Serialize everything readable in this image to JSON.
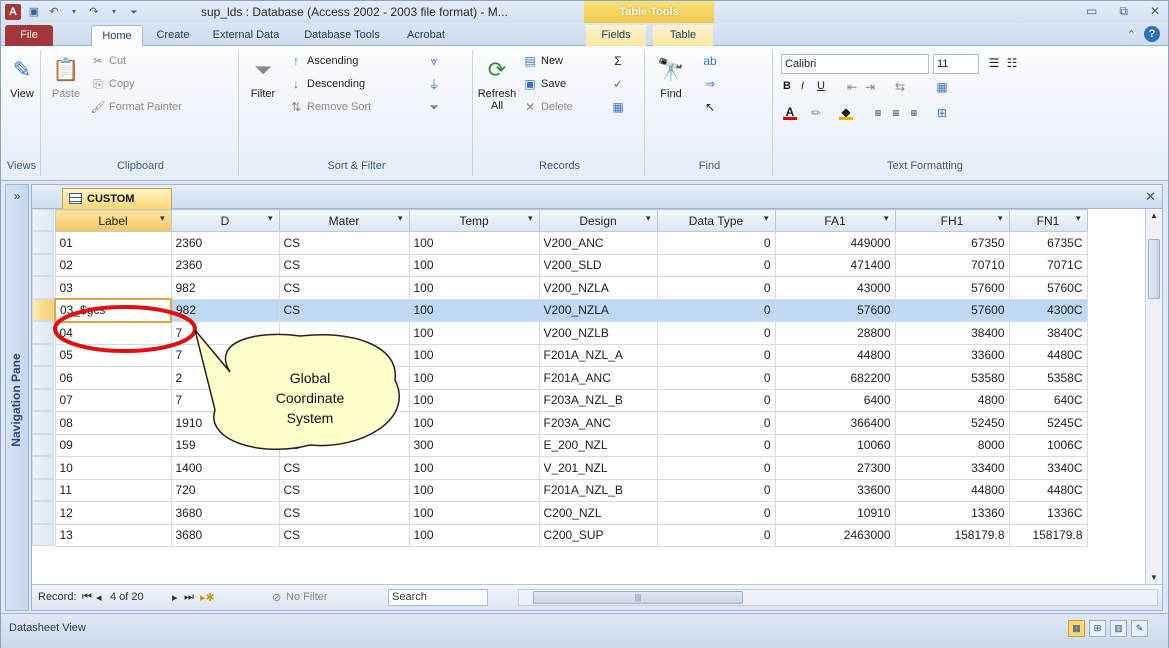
{
  "window": {
    "title": "sup_lds : Database (Access 2002 - 2003 file format)  -  M...",
    "context_tab_group": "Table Tools"
  },
  "tabs": [
    {
      "label": "File"
    },
    {
      "label": "Home"
    },
    {
      "label": "Create"
    },
    {
      "label": "External Data"
    },
    {
      "label": "Database Tools"
    },
    {
      "label": "Acrobat"
    },
    {
      "label": "Fields"
    },
    {
      "label": "Table"
    }
  ],
  "ribbon": {
    "views": {
      "view_label": "View",
      "group_label": "Views"
    },
    "clipboard": {
      "paste": "Paste",
      "cut": "Cut",
      "copy": "Copy",
      "format_painter": "Format Painter",
      "group_label": "Clipboard"
    },
    "sort_filter": {
      "filter": "Filter",
      "ascending": "Ascending",
      "descending": "Descending",
      "remove_sort": "Remove Sort",
      "group_label": "Sort & Filter"
    },
    "records": {
      "refresh": "Refresh",
      "refresh_sub": "All",
      "new": "New",
      "save": "Save",
      "delete": "Delete",
      "group_label": "Records"
    },
    "find": {
      "find": "Find",
      "group_label": "Find"
    },
    "text_formatting": {
      "font": "Calibri",
      "size": "11",
      "group_label": "Text Formatting"
    }
  },
  "navigation_pane": {
    "label": "Navigation Pane"
  },
  "document": {
    "tab_label": "CUSTOM",
    "columns": [
      "Label",
      "D",
      "Mater",
      "Temp",
      "Design",
      "Data Type",
      "FA1",
      "FH1",
      "FN1"
    ],
    "rows": [
      [
        "01",
        "2360",
        "CS",
        "100",
        "V200_ANC",
        "0",
        "449000",
        "67350",
        "6735C"
      ],
      [
        "02",
        "2360",
        "CS",
        "100",
        "V200_SLD",
        "0",
        "471400",
        "70710",
        "7071C"
      ],
      [
        "03",
        "982",
        "CS",
        "100",
        "V200_NZLA",
        "0",
        "43000",
        "57600",
        "5760C"
      ],
      [
        "03_$gcs",
        "982",
        "CS",
        "100",
        "V200_NZLA",
        "0",
        "57600",
        "57600",
        "4300C"
      ],
      [
        "04",
        "7",
        "",
        "100",
        "V200_NZLB",
        "0",
        "28800",
        "38400",
        "3840C"
      ],
      [
        "05",
        "7",
        "",
        "100",
        "F201A_NZL_A",
        "0",
        "44800",
        "33600",
        "4480C"
      ],
      [
        "06",
        "2",
        "",
        "100",
        "F201A_ANC",
        "0",
        "682200",
        "53580",
        "5358C"
      ],
      [
        "07",
        "7",
        "",
        "100",
        "F203A_NZL_B",
        "0",
        "6400",
        "4800",
        "640C"
      ],
      [
        "08",
        "1910",
        "",
        "100",
        "F203A_ANC",
        "0",
        "366400",
        "52450",
        "5245C"
      ],
      [
        "09",
        "159",
        "CS",
        "300",
        "E_200_NZL",
        "0",
        "10060",
        "8000",
        "1006C"
      ],
      [
        "10",
        "1400",
        "CS",
        "100",
        "V_201_NZL",
        "0",
        "27300",
        "33400",
        "3340C"
      ],
      [
        "11",
        "720",
        "CS",
        "100",
        "F201A_NZL_B",
        "0",
        "33600",
        "44800",
        "4480C"
      ],
      [
        "12",
        "3680",
        "CS",
        "100",
        "C200_NZL",
        "0",
        "10910",
        "13360",
        "1336C"
      ],
      [
        "13",
        "3680",
        "CS",
        "100",
        "C200_SUP",
        "0",
        "2463000",
        "158179.8",
        "158179.8"
      ]
    ]
  },
  "record_nav": {
    "prefix": "Record:",
    "position": "4 of 20",
    "no_filter": "No Filter",
    "search": "Search"
  },
  "status": {
    "text": "Datasheet View"
  },
  "annotation": {
    "line1": "Global",
    "line2": "Coordinate",
    "line3": "System"
  }
}
